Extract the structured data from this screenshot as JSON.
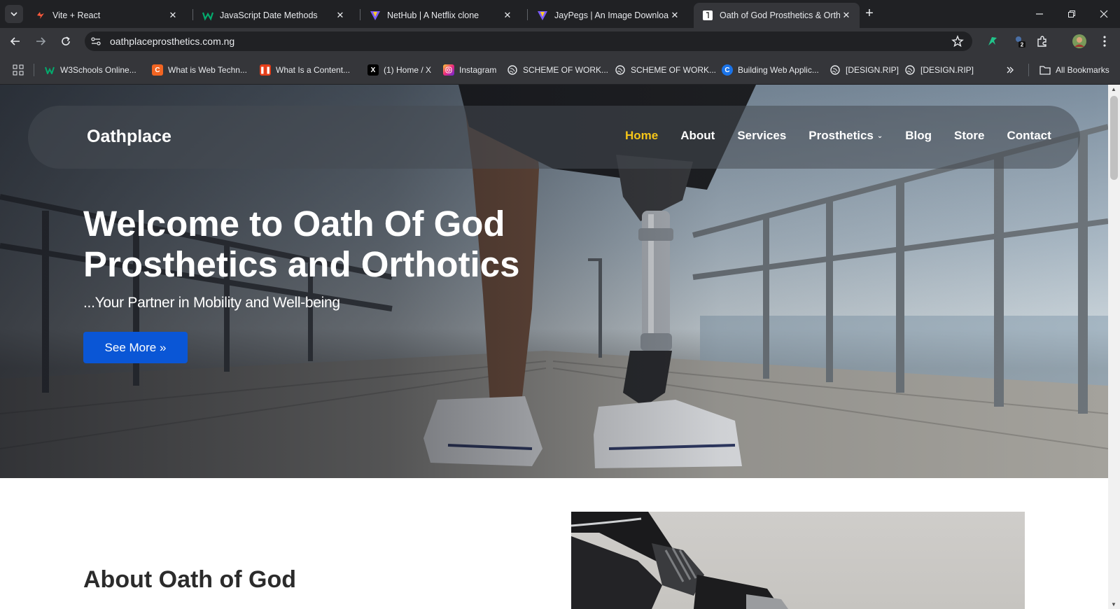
{
  "browser": {
    "tabs": [
      {
        "title": "Vite + React",
        "favicon": "vite-icon"
      },
      {
        "title": "JavaScript Date Methods",
        "favicon": "w3schools-icon"
      },
      {
        "title": "NetHub | A Netflix clone",
        "favicon": "vite-icon"
      },
      {
        "title": "JayPegs | An Image Downloadin",
        "favicon": "vite-icon"
      },
      {
        "title": "Oath of God Prosthetics & Orth",
        "favicon": "site-icon"
      }
    ],
    "active_tab_index": 4,
    "url": "oathplaceprosthetics.com.ng",
    "extension_badge": "2",
    "bookmarks": [
      {
        "label": "W3Schools Online...",
        "icon": "w3schools-icon"
      },
      {
        "label": "What is Web Techn...",
        "icon": "cc-icon"
      },
      {
        "label": "What Is a Content...",
        "icon": "content-icon"
      },
      {
        "label": "(1) Home / X",
        "icon": "x-icon"
      },
      {
        "label": "Instagram",
        "icon": "instagram-icon"
      },
      {
        "label": "SCHEME OF WORK...",
        "icon": "globe-icon"
      },
      {
        "label": "SCHEME OF WORK...",
        "icon": "globe-icon"
      },
      {
        "label": "Building Web Applic...",
        "icon": "c-icon"
      },
      {
        "label": "[DESIGN.RIP]",
        "icon": "globe-icon"
      },
      {
        "label": "[DESIGN.RIP]",
        "icon": "globe-icon"
      }
    ],
    "all_bookmarks": "All Bookmarks"
  },
  "site": {
    "brand": "Oathplace",
    "nav": [
      {
        "label": "Home",
        "active": true
      },
      {
        "label": "About",
        "active": false
      },
      {
        "label": "Services",
        "active": false
      },
      {
        "label": "Prosthetics",
        "active": false,
        "dropdown": true
      },
      {
        "label": "Blog",
        "active": false
      },
      {
        "label": "Store",
        "active": false
      },
      {
        "label": "Contact",
        "active": false
      }
    ],
    "hero": {
      "title_line1": "Welcome to Oath Of God",
      "title_line2": "Prosthetics and Orthotics",
      "subtitle": "...Your Partner in Mobility and Well-being",
      "button": "See More »"
    },
    "about": {
      "heading": "About Oath of God"
    }
  },
  "colors": {
    "nav_active": "#f5c518",
    "button_blue": "#0a56d6",
    "chrome_dark": "#202124",
    "chrome_mid": "#35363a"
  }
}
